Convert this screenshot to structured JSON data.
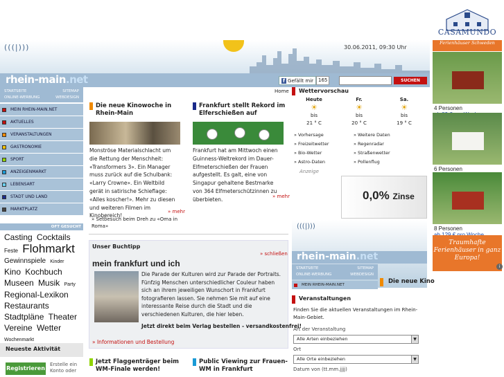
{
  "header": {
    "site_name_main": "rhein-main",
    "site_name_tld": ".net",
    "datetime": "30.06.2011, 09:30 Uhr",
    "facebook_label": "Gefällt mir",
    "facebook_count": "165",
    "search_button": "SUCHEN",
    "home_link": "Home"
  },
  "nav": {
    "top_left_1": "STARTSEITE",
    "top_right_1": "SITEMAP",
    "top_left_2": "ONLINE-WERBUNG",
    "top_right_2": "WEBDESIGN",
    "items": [
      {
        "label": "MEIN RHEIN-MAIN.NET",
        "color": "#c41010"
      },
      {
        "label": "AKTUELLES",
        "color": "#c41010"
      },
      {
        "label": "VERANSTALTUNGEN",
        "color": "#f08a00"
      },
      {
        "label": "GASTRONOMIE",
        "color": "#f0c000"
      },
      {
        "label": "SPORT",
        "color": "#8fd400"
      },
      {
        "label": "ANZEIGENMARKT",
        "color": "#1a9ad6"
      },
      {
        "label": "LEBENSART",
        "color": "#6ad0f0"
      },
      {
        "label": "STADT UND LAND",
        "color": "#1a2a8a"
      },
      {
        "label": "MARKTPLATZ",
        "color": "#444444"
      }
    ],
    "oft_gesucht": "OFT GESUCHT"
  },
  "tags": [
    {
      "text": "Casting",
      "size": 12
    },
    {
      "text": "Cocktails",
      "size": 12
    },
    {
      "text": "Feste",
      "size": 8
    },
    {
      "text": "Flohmarkt",
      "size": 17
    },
    {
      "text": "Gewinnspiele",
      "size": 10
    },
    {
      "text": "Kinder",
      "size": 7
    },
    {
      "text": "Kino",
      "size": 12
    },
    {
      "text": "Kochbuch",
      "size": 12
    },
    {
      "text": "Museen",
      "size": 12
    },
    {
      "text": "Musik",
      "size": 12
    },
    {
      "text": "Party",
      "size": 7
    },
    {
      "text": "Regional-Lexikon",
      "size": 12
    },
    {
      "text": "Restaurants",
      "size": 12
    },
    {
      "text": "Stadtpläne",
      "size": 12
    },
    {
      "text": "Theater",
      "size": 12
    },
    {
      "text": "Vereine",
      "size": 12
    },
    {
      "text": "Wetter",
      "size": 12
    },
    {
      "text": "Wochenmarkt",
      "size": 7
    }
  ],
  "activity": {
    "title": "Neueste Aktivität",
    "register": "Registrieren",
    "note": "Erstelle ein Konto oder"
  },
  "articles": {
    "kino": {
      "title": "Die neue Kinowoche in Rhein-Main",
      "text": "Monströse Materialschlacht um die Rettung der Menschheit: «Transformers 3». Ein Manager muss zurück auf die Schulbank: «Larry Crowne». Ein Weltbild gerät in satirische Schieflage: «Alles koscher!». Mehr zu diesen und weiteren Filmen im Kinobereich!",
      "mehr": "» mehr",
      "subnote": "» Setbesuch beim Dreh zu «Oma in Roma»"
    },
    "frankfurt": {
      "title": "Frankfurt stellt Rekord im Elferschießen auf",
      "text": "Frankfurt hat am Mittwoch einen Guinness-Weltrekord im Dauer-Elfmeterschießen der Frauen aufgestellt. Es galt, eine von Singapur gehaltene Bestmarke von 364 Elfmeterschützinnen zu überbieten.",
      "mehr": "» mehr"
    },
    "flaggen": {
      "title": "Jetzt Flaggenträger beim WM-Finale werden!"
    },
    "public": {
      "title": "Public Viewing zur Frauen-WM in Frankfurt"
    }
  },
  "buchtipp": {
    "label": "Unser Buchtipp",
    "close": "» schließen",
    "title": "mein frankfurt und ich",
    "text": "Die Parade der Kulturen wird zur Parade der Portraits. Fünfzig Menschen unterschiedlicher Couleur haben sich an ihrem jeweiligen Wunschort in Frankfurt fotografieren lassen. Sie nehmen Sie mit auf eine interessante Reise durch die Stadt und die verschiedenen Kulturen, die hier leben.",
    "bold": "Jetzt direkt beim Verlag bestellen - versandkostenfrei!",
    "link": "» Informationen und Bestellung"
  },
  "weather": {
    "title": "Wettervorschau",
    "days": [
      {
        "day": "Heute",
        "desc": "bis",
        "temp": "21 ° C"
      },
      {
        "day": "Fr.",
        "desc": "bis",
        "temp": "20 ° C"
      },
      {
        "day": "Sa.",
        "desc": "bis",
        "temp": "19 ° C"
      }
    ],
    "links_left": [
      "» Vorhersage",
      "» Freizeitwetter",
      "» Bio-Wetter",
      "» Astro-Daten"
    ],
    "links_right": [
      "» Weitere Daten",
      "» Regenradar",
      "» Straßenwetter",
      "» Pollenflug"
    ],
    "anzeige": "Anzeige"
  },
  "ad_zins": {
    "main": "0,0%",
    "sub": "Zinse"
  },
  "embed": {
    "site_main": "rhein-main",
    "site_tld": ".net",
    "nav_left_1": "STARTSEITE",
    "nav_right_1": "SITEMAP",
    "nav_left_2": "ONLINE-WERBUNG",
    "nav_right_2": "WEBDESIGN",
    "nav_item": "MEIN RHEIN-MAIN.NET",
    "kino_title": "Die neue Kino"
  },
  "events": {
    "title": "Veranstaltungen",
    "text": "Finden Sie die aktuellen Veranstaltungen im Rhein-Main-Gebiet.",
    "art_label": "Art der Veranstaltung",
    "art_value": "Alle Arten einbeziehen",
    "ort_label": "Ort",
    "ort_value": "Alle Orte einbeziehen",
    "datum_label": "Datum von (tt.mm.jjjj)"
  },
  "casamundo": {
    "brand": "CASAMUNDO",
    "banner": "Ferienhäuser Schweden",
    "houses": [
      {
        "persons": "4 Personen",
        "price": "ab 89 € pro Woche"
      },
      {
        "persons": "6 Personen",
        "price": "ab 99 € pro Woche"
      },
      {
        "persons": "8 Personen",
        "price": "ab 129 € pro Woche"
      }
    ],
    "slogan": "Traumhafte Ferienhäuser in ganz Europa!",
    "info": "i"
  }
}
